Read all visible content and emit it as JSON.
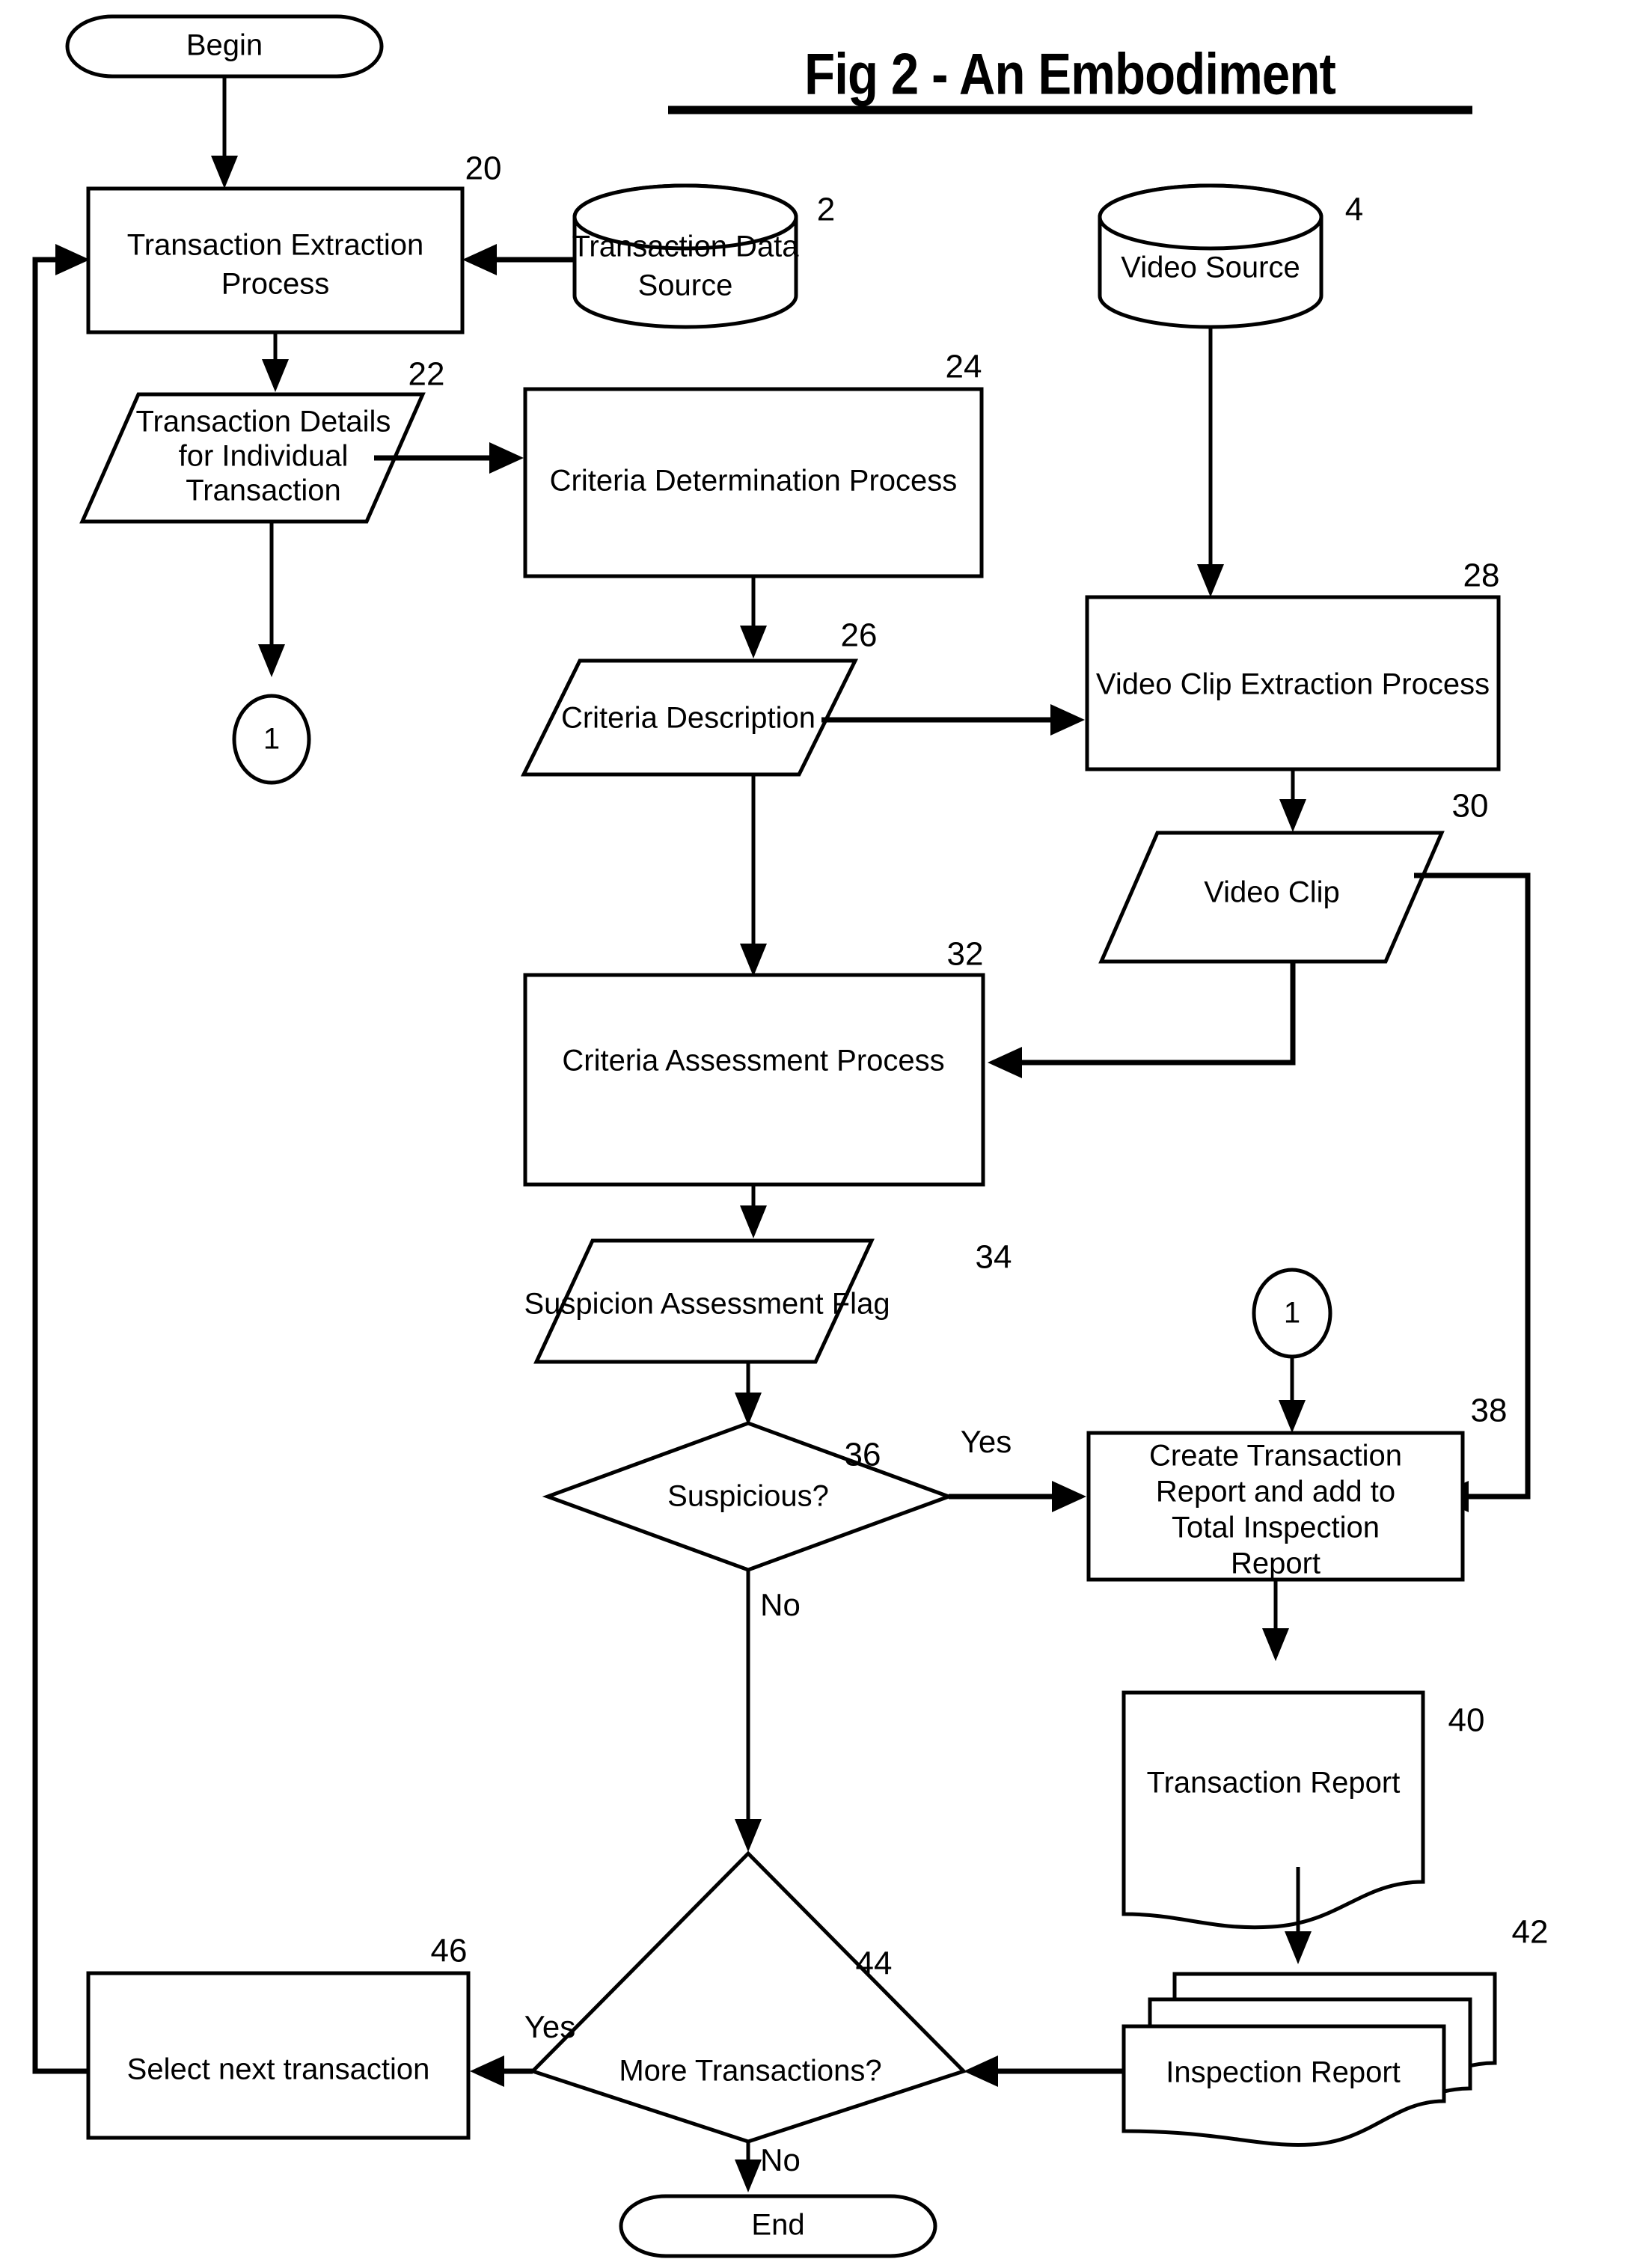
{
  "figure": {
    "title": "Fig 2 - An Embodiment"
  },
  "nodes": {
    "begin": {
      "label": "Begin",
      "ref": ""
    },
    "transaction_extraction": {
      "line1": "Transaction Extraction",
      "line2": "Process",
      "ref": "20"
    },
    "transaction_data_source": {
      "line1": "Transaction Data",
      "line2": "Source",
      "ref": "2"
    },
    "video_source": {
      "label": "Video Source",
      "ref": "4"
    },
    "transaction_details": {
      "line1": "Transaction Details",
      "line2": "for Individual",
      "line3": "Transaction",
      "ref": "22"
    },
    "criteria_determination": {
      "label": "Criteria Determination Process",
      "ref": "24"
    },
    "connector_out": {
      "label": "1",
      "ref": ""
    },
    "criteria_description": {
      "label": "Criteria Description",
      "ref": "26"
    },
    "video_clip_extraction": {
      "label": "Video Clip Extraction Process",
      "ref": "28"
    },
    "video_clip": {
      "label": "Video Clip",
      "ref": "30"
    },
    "criteria_assessment": {
      "label": "Criteria Assessment Process",
      "ref": "32"
    },
    "suspicion_flag": {
      "label": "Suspicion Assessment Flag",
      "ref": "34"
    },
    "suspicious_decision": {
      "label": "Suspicious?",
      "ref": "36"
    },
    "connector_in": {
      "label": "1",
      "ref": ""
    },
    "create_transaction_report": {
      "line1": "Create Transaction",
      "line2": "Report and add to",
      "line3": "Total Inspection",
      "line4": "Report",
      "ref": "38"
    },
    "transaction_report": {
      "label": "Transaction Report",
      "ref": "40"
    },
    "inspection_report": {
      "label": "Inspection Report",
      "ref": "42"
    },
    "more_transactions_decision": {
      "label": "More Transactions?",
      "ref": "44"
    },
    "select_next_transaction": {
      "label": "Select next transaction",
      "ref": "46"
    },
    "end": {
      "label": "End",
      "ref": ""
    }
  },
  "edge_labels": {
    "suspicious_yes": "Yes",
    "suspicious_no": "No",
    "more_transactions_yes": "Yes",
    "more_transactions_no": "No"
  },
  "colors": {
    "stroke": "#000000",
    "fill": "#ffffff",
    "background": "#ffffff"
  }
}
